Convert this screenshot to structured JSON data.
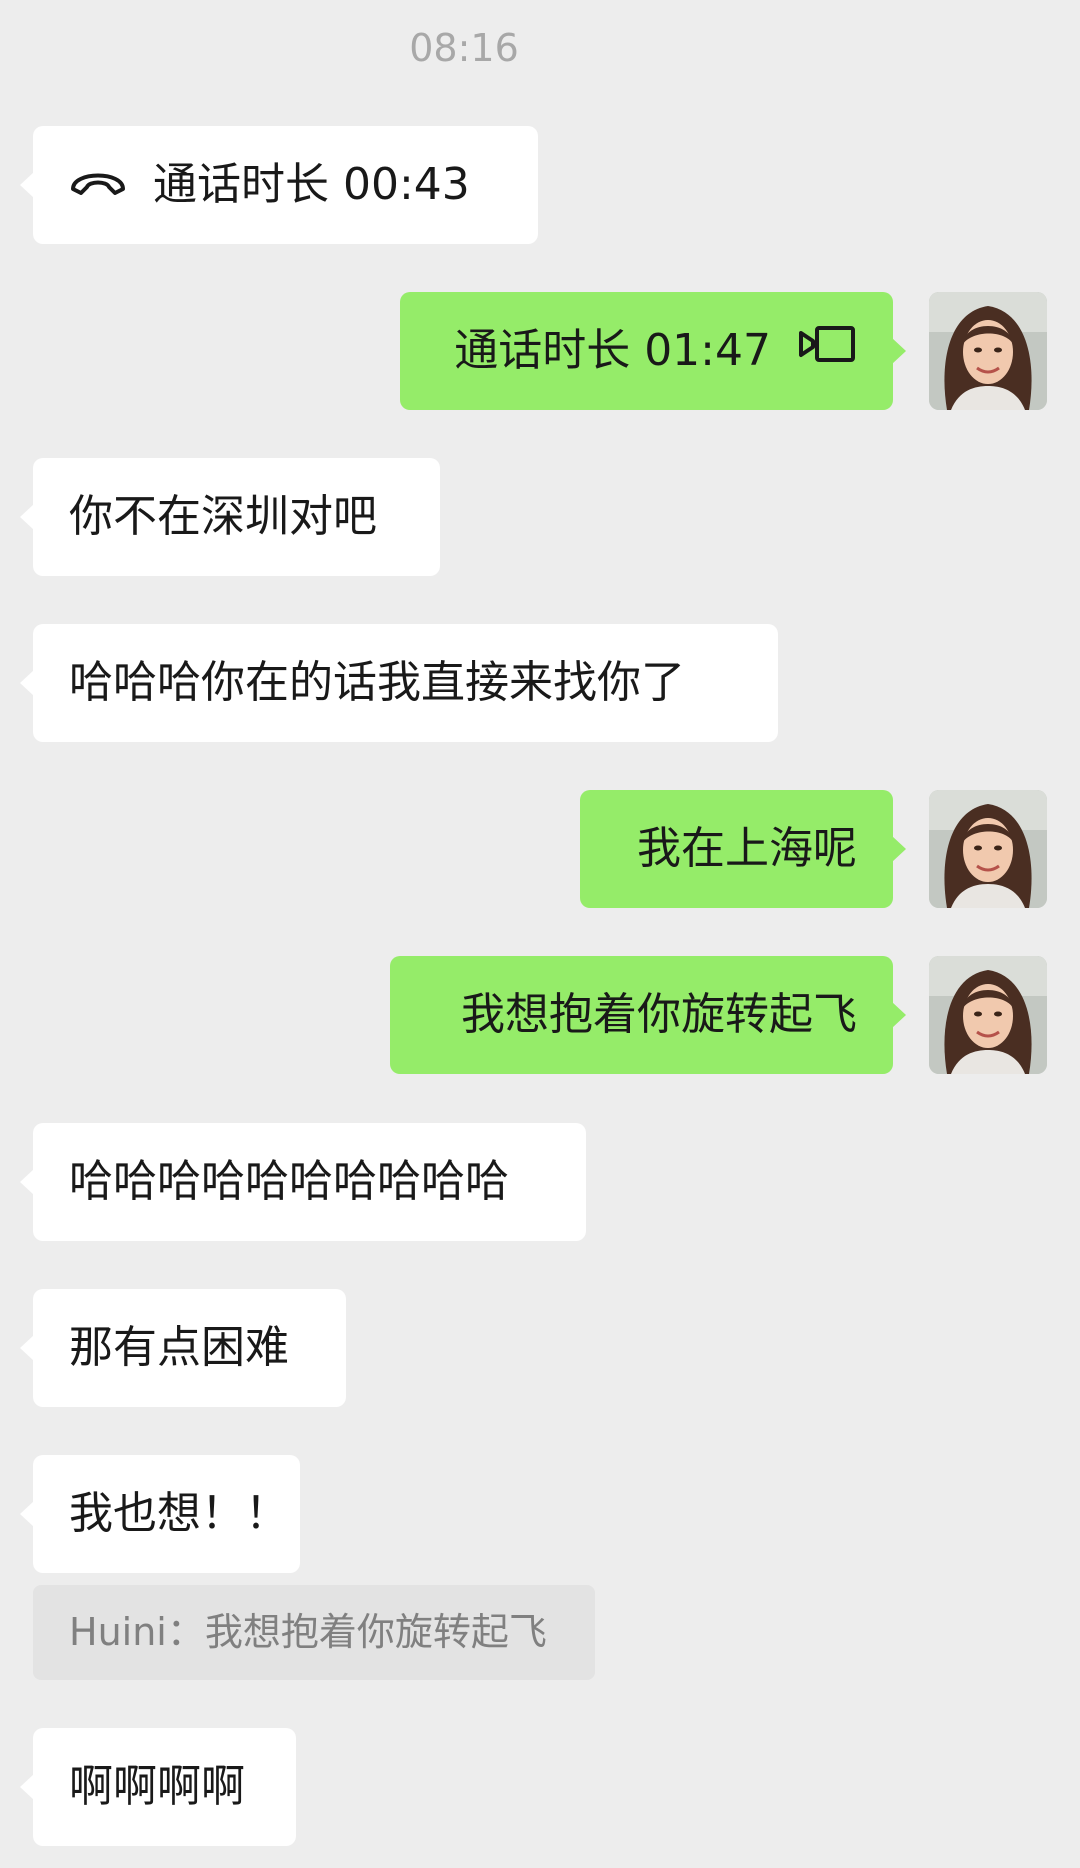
{
  "chat": {
    "timestamp": "08:16",
    "messages": [
      {
        "side": "in",
        "type": "voice-call",
        "icon": "phone-hangup-icon",
        "text": "通话时长 00:43"
      },
      {
        "side": "out",
        "type": "video-call",
        "icon": "video-camera-icon",
        "text": "通话时长 01:47"
      },
      {
        "side": "in",
        "type": "text",
        "text": "你不在深圳对吧"
      },
      {
        "side": "in",
        "type": "text",
        "text": "哈哈哈你在的话我直接来找你了"
      },
      {
        "side": "out",
        "type": "text",
        "text": "我在上海呢"
      },
      {
        "side": "out",
        "type": "text",
        "text": "我想抱着你旋转起飞"
      },
      {
        "side": "in",
        "type": "text",
        "text": "哈哈哈哈哈哈哈哈哈哈"
      },
      {
        "side": "in",
        "type": "text",
        "text": "那有点困难"
      },
      {
        "side": "in",
        "type": "text",
        "text": "我也想！！"
      },
      {
        "side": "in",
        "type": "text",
        "text": "啊啊啊啊"
      }
    ],
    "quote": {
      "text": "Huini：我想抱着你旋转起飞"
    }
  },
  "colors": {
    "background": "#EDEDED",
    "incoming_bubble": "#FFFFFF",
    "outgoing_bubble": "#95EC69",
    "timestamp_text": "#A8A8A8",
    "quote_background": "#E3E3E3",
    "quote_text": "#808080"
  }
}
